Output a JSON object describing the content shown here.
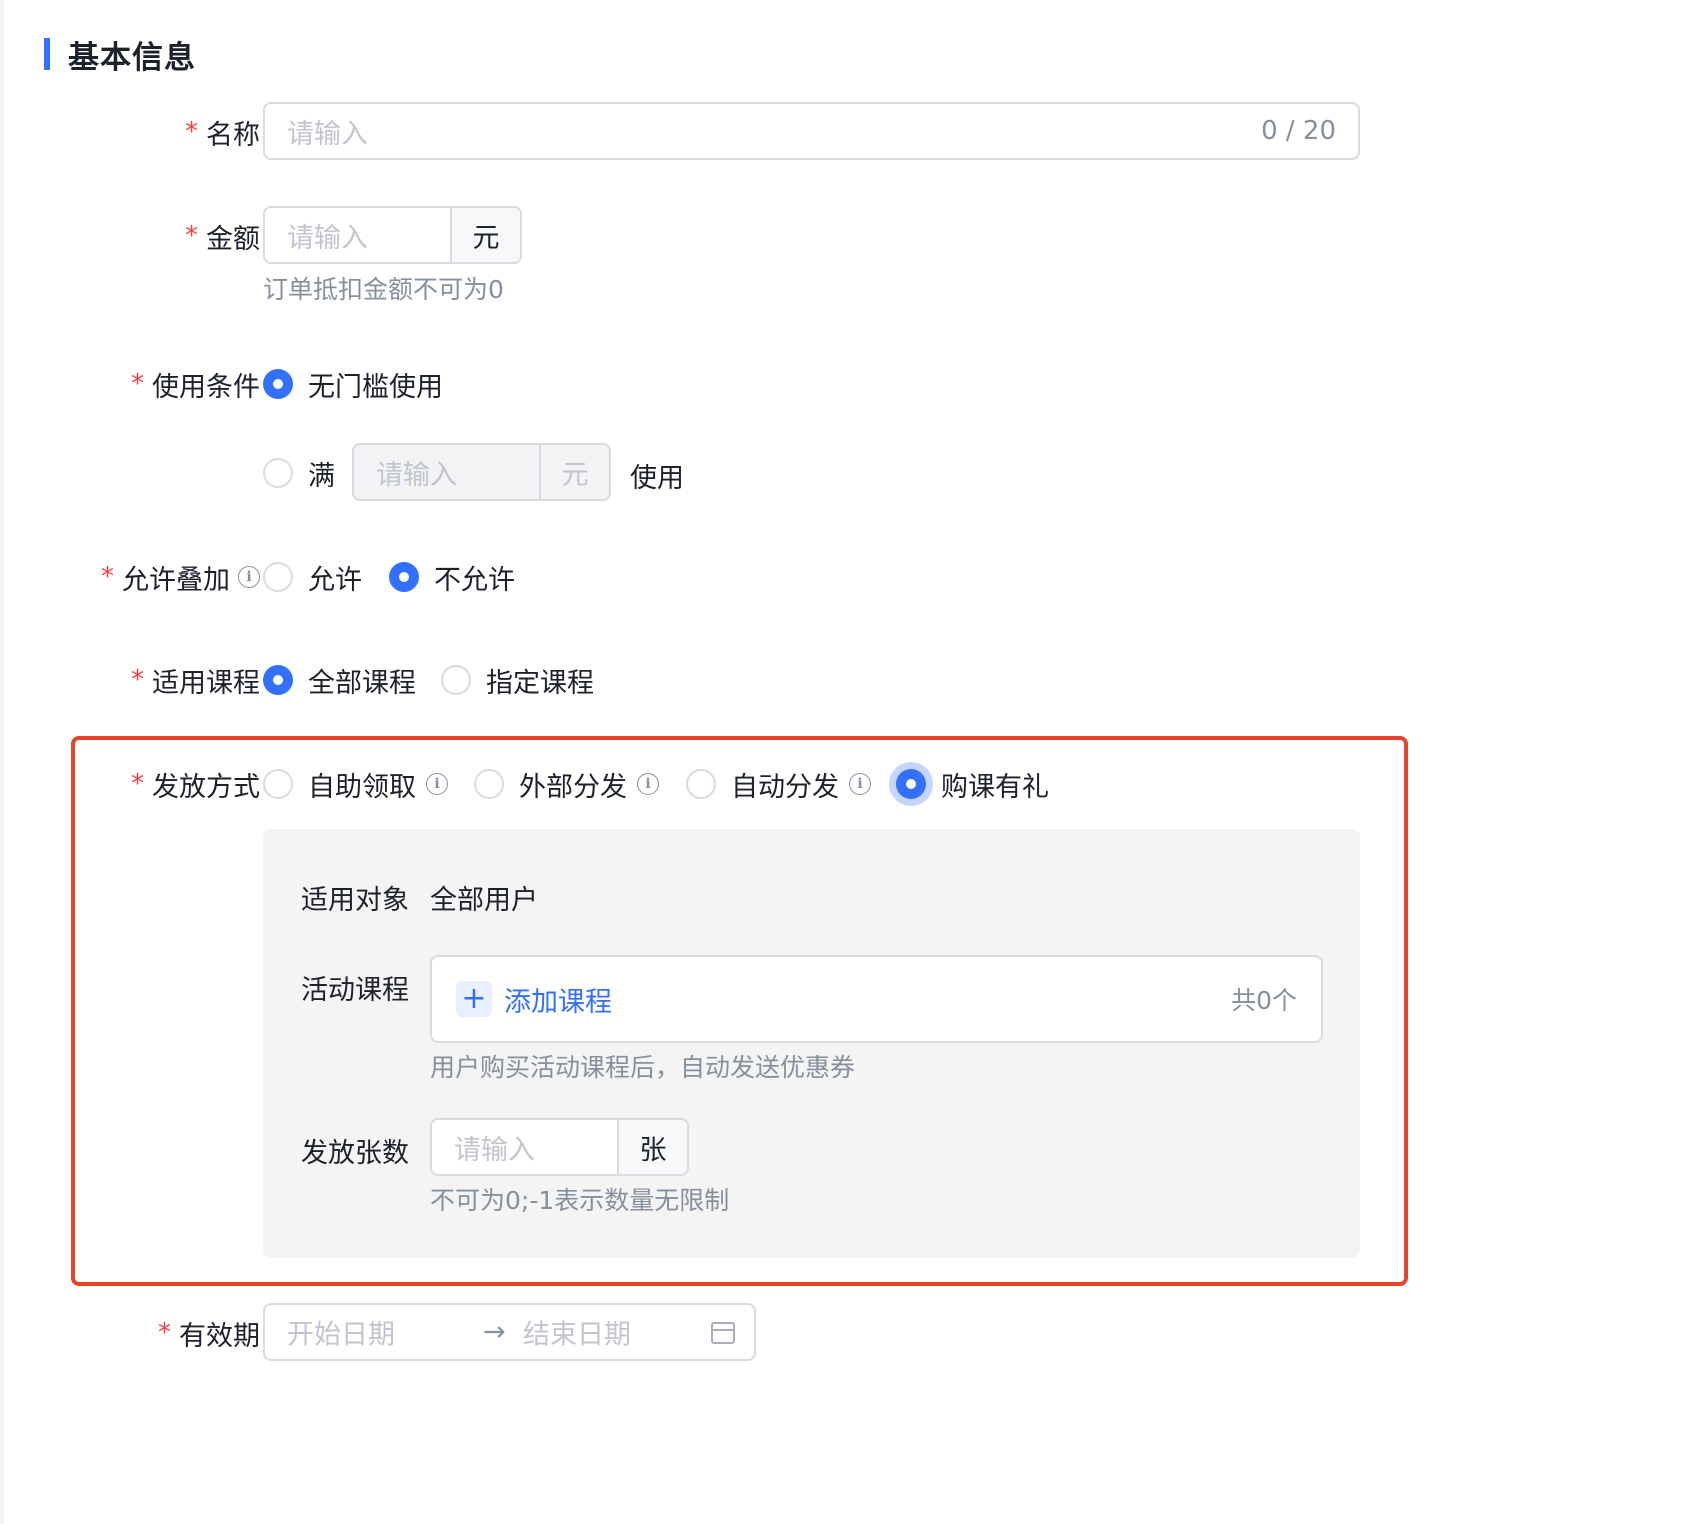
{
  "section": {
    "title": "基本信息"
  },
  "required_mark": "*",
  "name": {
    "label": "名称",
    "placeholder": "请输入",
    "counter": "0 / 20"
  },
  "amount": {
    "label": "金额",
    "placeholder": "请输入",
    "suffix": "元",
    "help": "订单抵扣金额不可为0"
  },
  "usage_condition": {
    "label": "使用条件",
    "option_no_threshold": "无门槛使用",
    "option_full_prefix": "满",
    "option_full_placeholder": "请输入",
    "option_full_suffix": "元",
    "option_full_after": "使用",
    "selected": "无门槛使用"
  },
  "stacking": {
    "label": "允许叠加",
    "options": [
      "允许",
      "不允许"
    ],
    "selected": "不允许"
  },
  "applicable_courses": {
    "label": "适用课程",
    "options": [
      "全部课程",
      "指定课程"
    ],
    "selected": "全部课程"
  },
  "distribution": {
    "label": "发放方式",
    "options": [
      "自助领取",
      "外部分发",
      "自动分发",
      "购课有礼"
    ],
    "selected": "购课有礼",
    "target": {
      "label": "适用对象",
      "value": "全部用户"
    },
    "activity_courses": {
      "label": "活动课程",
      "add_label": "添加课程",
      "count": "共0个",
      "help": "用户购买活动课程后，自动发送优惠券"
    },
    "quantity": {
      "label": "发放张数",
      "placeholder": "请输入",
      "suffix": "张",
      "help": "不可为0;-1表示数量无限制"
    }
  },
  "validity": {
    "label": "有效期",
    "start_placeholder": "开始日期",
    "separator": "→",
    "end_placeholder": "结束日期"
  },
  "colors": {
    "primary": "#3370ff",
    "required": "#f53f3f",
    "highlight_border": "#e8432d"
  },
  "icons": {
    "info": "info-circle-icon",
    "add": "plus-icon",
    "calendar": "calendar-icon"
  }
}
